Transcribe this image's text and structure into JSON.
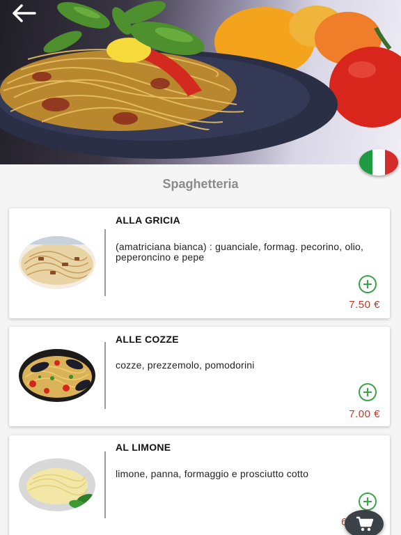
{
  "header": {
    "back_icon": "arrow-left-icon",
    "hero_image": "spaghetti-with-basil-and-tomatoes",
    "language_flag": "italy-flag"
  },
  "section": {
    "title": "Spaghetteria"
  },
  "menu_items": [
    {
      "name": "ALLA GRICIA",
      "description": "(amatriciana bianca) : guanciale, formag. pecorino, olio, peperoncino e pepe",
      "price": "7.50 €",
      "image": "pasta-alla-gricia"
    },
    {
      "name": "ALLE COZZE",
      "description": "cozze, prezzemolo, pomodorini",
      "price": "7.00 €",
      "image": "spaghetti-with-mussels"
    },
    {
      "name": "AL LIMONE",
      "description": "limone, panna, formaggio e prosciutto cotto",
      "price": "6.",
      "image": "tagliatelle-al-limone"
    }
  ],
  "colors": {
    "price": "#c0392b",
    "add_button": "#3aa34a",
    "cart_button": "#3b4146",
    "section_title": "#8a8a8a"
  },
  "cart": {
    "icon": "shopping-cart-icon"
  }
}
